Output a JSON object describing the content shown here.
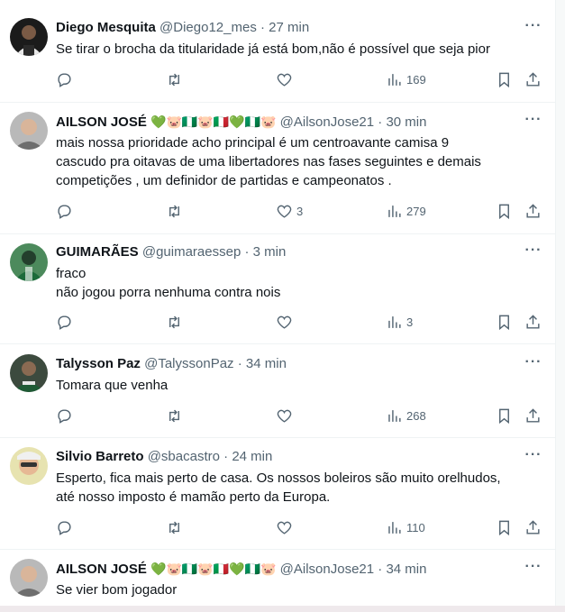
{
  "colors": {
    "text": "#0f1419",
    "secondary": "#536471",
    "divider": "#eff3f4"
  },
  "icons": {
    "reply": "reply-icon",
    "retweet": "retweet-icon",
    "like": "heart-icon",
    "views": "views-icon",
    "bookmark": "bookmark-icon",
    "share": "share-icon",
    "more": "more-icon"
  },
  "tweets": [
    {
      "name": "Diego Mesquita",
      "emojis": "",
      "handle": "@Diego12_mes",
      "dot": "·",
      "time": "27 min",
      "text": "Se tirar o brocha da titularidade já está bom,não é possível que seja pior",
      "replies": "",
      "retweets": "",
      "likes": "",
      "views": "169"
    },
    {
      "name": "AILSON JOSÉ",
      "emojis": "💚🐷🇳🇬🐷🇮🇹💚🇳🇬🐷",
      "handle": "@AilsonJose21",
      "dot": "·",
      "time": "30 min",
      "text": "mais nossa prioridade acho  principal  é  um centroavante  camisa  9\ncascudo pra  oitavas de uma libertadores  nas fases  seguintes  e  demais\ncompetições ,  um definidor de partidas e  campeonatos .",
      "replies": "",
      "retweets": "",
      "likes": "3",
      "views": "279"
    },
    {
      "name": "GUIMARÃES",
      "emojis": "",
      "handle": "@guimaraessep",
      "dot": "·",
      "time": "3 min",
      "text": "fraco\nnão jogou porra nenhuma contra nois",
      "replies": "",
      "retweets": "",
      "likes": "",
      "views": "3"
    },
    {
      "name": "Talysson Paz",
      "emojis": "",
      "handle": "@TalyssonPaz",
      "dot": "·",
      "time": "34 min",
      "text": "Tomara que venha",
      "replies": "",
      "retweets": "",
      "likes": "",
      "views": "268"
    },
    {
      "name": "Silvio Barreto",
      "emojis": "",
      "handle": "@sbacastro",
      "dot": "·",
      "time": "24 min",
      "text": "Esperto, fica mais perto de casa. Os nossos boleiros são muito orelhudos,\naté nosso imposto é mamão perto da Europa.",
      "replies": "",
      "retweets": "",
      "likes": "",
      "views": "110"
    },
    {
      "name": "AILSON JOSÉ",
      "emojis": "💚🐷🇳🇬🐷🇮🇹💚🇳🇬🐷",
      "handle": "@AilsonJose21",
      "dot": "·",
      "time": "34 min",
      "text": "Se vier bom jogador",
      "replies": "",
      "retweets": "",
      "likes": "",
      "views": ""
    }
  ]
}
